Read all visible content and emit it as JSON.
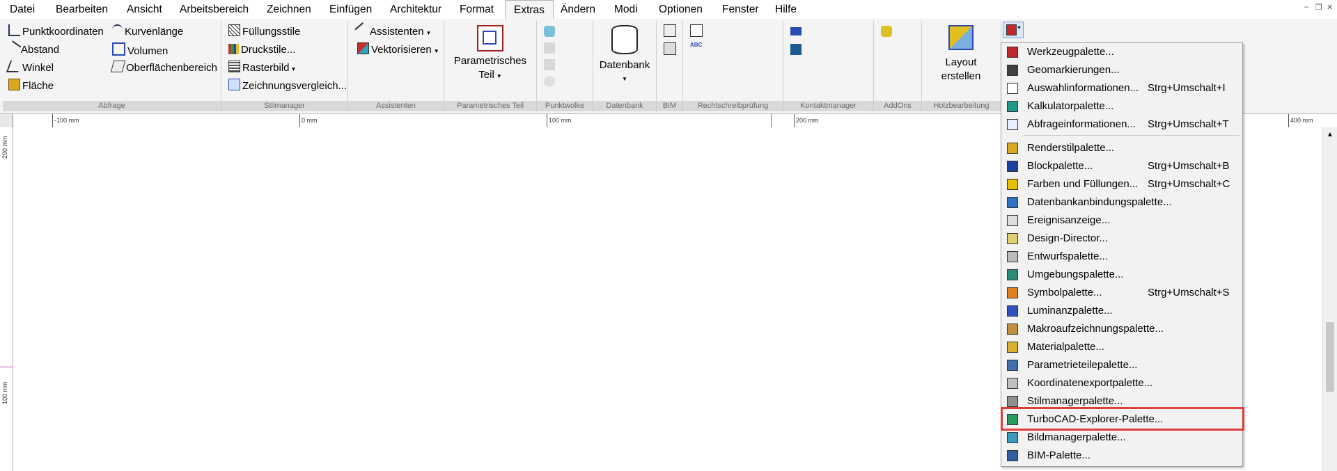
{
  "menubar": {
    "items": [
      "Datei",
      "Bearbeiten",
      "Ansicht",
      "Arbeitsbereich",
      "Zeichnen",
      "Einfügen",
      "Architektur",
      "Format",
      "Extras",
      "Ändern",
      "Modi",
      "Optionen",
      "Fenster",
      "Hilfe"
    ],
    "active": "Extras"
  },
  "ribbon": {
    "abfrage": {
      "label": "Abfrage",
      "punktkoordinaten": "Punktkoordinaten",
      "abstand": "Abstand",
      "winkel": "Winkel",
      "flaeche": "Fläche",
      "kurvenlaenge": "Kurvenlänge",
      "volumen": "Volumen",
      "oberflaechenbereich": "Oberflächenbereich"
    },
    "stilmanager": {
      "label": "Stilmanager",
      "fuellungsstile": "Füllungsstile",
      "druckstile": "Druckstile...",
      "rasterbild": "Rasterbild",
      "zeichnungsvergleich": "Zeichnungsvergleich..."
    },
    "assistenten": {
      "label": "Assistenten",
      "assistenten": "Assistenten",
      "vektorisieren": "Vektorisieren"
    },
    "param_teil": {
      "label": "Parametrisches Teil",
      "btn_line1": "Parametrisches",
      "btn_line2": "Teil"
    },
    "punktwolke": {
      "label": "Punktwolke"
    },
    "datenbank": {
      "label": "Datenbank",
      "btn": "Datenbank"
    },
    "bim": {
      "label": "BIM"
    },
    "rechtschreib": {
      "label": "Rechtschreibprüfung"
    },
    "kontakt": {
      "label": "Kontaktmanager"
    },
    "addons": {
      "label": "AddOns"
    },
    "holz": {
      "label": "Holzbearbeitung",
      "btn_line1": "Layout",
      "btn_line2": "erstellen"
    }
  },
  "ruler": {
    "h_labels": [
      "-100 mm",
      "0 mm",
      "100 mm",
      "200 mm",
      "400 mm"
    ],
    "v_labels": [
      "200 mm",
      "100 mm"
    ]
  },
  "dropdown": {
    "items": [
      {
        "label": "Werkzeugpalette...",
        "shortcut": "",
        "icon_color": "#c0282d"
      },
      {
        "label": "Geomarkierungen...",
        "shortcut": "",
        "icon_color": "#404040"
      },
      {
        "label": "Auswahlinformationen...",
        "shortcut": "Strg+Umschalt+I",
        "icon_color": "#ffffff"
      },
      {
        "label": "Kalkulatorpalette...",
        "shortcut": "",
        "icon_color": "#1f9a8a"
      },
      {
        "label": "Abfrageinformationen...",
        "shortcut": "Strg+Umschalt+T",
        "icon_color": "#e8f0ff"
      },
      {
        "label": "Renderstilpalette...",
        "shortcut": "",
        "icon_color": "#d8a820"
      },
      {
        "label": "Blockpalette...",
        "shortcut": "Strg+Umschalt+B",
        "icon_color": "#2040a0"
      },
      {
        "label": "Farben und Füllungen...",
        "shortcut": "Strg+Umschalt+C",
        "icon_color": "#e8c000"
      },
      {
        "label": "Datenbankanbindungspalette...",
        "shortcut": "",
        "icon_color": "#3070c0"
      },
      {
        "label": "Ereignisanzeige...",
        "shortcut": "",
        "icon_color": "#dddddd"
      },
      {
        "label": "Design-Director...",
        "shortcut": "",
        "icon_color": "#e0d070"
      },
      {
        "label": "Entwurfspalette...",
        "shortcut": "",
        "icon_color": "#bbbbbb"
      },
      {
        "label": "Umgebungspalette...",
        "shortcut": "",
        "icon_color": "#2a8a7a"
      },
      {
        "label": "Symbolpalette...",
        "shortcut": "Strg+Umschalt+S",
        "icon_color": "#e08020"
      },
      {
        "label": "Luminanzpalette...",
        "shortcut": "",
        "icon_color": "#3050c0"
      },
      {
        "label": "Makroaufzeichnungspalette...",
        "shortcut": "",
        "icon_color": "#c09040"
      },
      {
        "label": "Materialpalette...",
        "shortcut": "",
        "icon_color": "#d8b030"
      },
      {
        "label": "Parametrieteilepalette...",
        "shortcut": "",
        "icon_color": "#4070b0"
      },
      {
        "label": "Koordinatenexportpalette...",
        "shortcut": "",
        "icon_color": "#c0c0c0"
      },
      {
        "label": "Stilmanagerpalette...",
        "shortcut": "",
        "icon_color": "#909090"
      },
      {
        "label": "TurboCAD-Explorer-Palette...",
        "shortcut": "",
        "icon_color": "#2a9a60"
      },
      {
        "label": "Bildmanagerpalette...",
        "shortcut": "",
        "icon_color": "#3a9ac0"
      },
      {
        "label": "BIM-Palette...",
        "shortcut": "",
        "icon_color": "#3060a0"
      }
    ],
    "highlighted": "TurboCAD-Explorer-Palette..."
  }
}
